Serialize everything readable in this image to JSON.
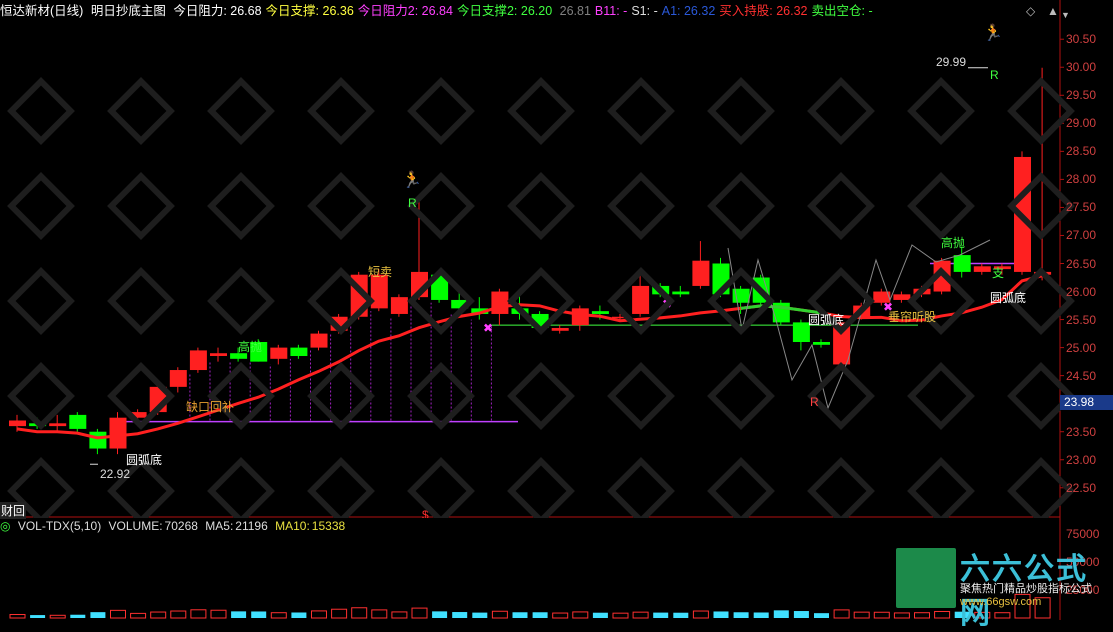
{
  "header": {
    "stock_name": "恒达新材(日线)",
    "indicator_name": "明日抄底主图",
    "items": [
      {
        "label": "今日阻力:",
        "value": "26.68",
        "color": "#ffffff"
      },
      {
        "label": "今日支撑:",
        "value": "26.36",
        "color": "#ffff40"
      },
      {
        "label": "今日阻力2:",
        "value": "26.84",
        "color": "#ff40ff"
      },
      {
        "label": "今日支撑2:",
        "value": "26.20",
        "color": "#40ff40"
      },
      {
        "label": "",
        "value": "26.81",
        "color": "#808080"
      },
      {
        "label": "B11:",
        "value": "-",
        "color": "#ff40ff"
      },
      {
        "label": "S1:",
        "value": "-",
        "color": "#dddddd"
      },
      {
        "label": "A1:",
        "value": "26.32",
        "color": "#2a58d8"
      },
      {
        "label": "买入持股:",
        "value": "26.32",
        "color": "#ff3030"
      },
      {
        "label": "卖出空仓:",
        "value": "-",
        "color": "#40ff40"
      }
    ],
    "controls": {
      "diamond": "◇",
      "up": "▲",
      "down": "▼"
    }
  },
  "colors": {
    "up": "#ff2020",
    "down": "#00ff00",
    "bg": "#000000",
    "axis": "#b01010"
  },
  "price_axis": {
    "ticks": [
      "30.50",
      "30.00",
      "29.50",
      "29.00",
      "28.50",
      "28.00",
      "27.50",
      "27.00",
      "26.50",
      "26.00",
      "25.50",
      "25.00",
      "24.50",
      "24.00",
      "23.50",
      "23.00",
      "22.50"
    ],
    "current_price": "23.98"
  },
  "volume_header": {
    "name": "VOL-TDX(5,10)",
    "volume_label": "VOLUME:",
    "volume": "70268",
    "ma5_label": "MA5:",
    "ma5": "21196",
    "ma10_label": "MA10:",
    "ma10": "15338"
  },
  "volume_axis": {
    "ticks": [
      "75000",
      "50000",
      "25000"
    ]
  },
  "annotations": {
    "peak_high": "29.99",
    "low": "22.92",
    "yuanhudi1": "圆弧底",
    "yuanhudi2": "圆弧底",
    "yuanhudi3": "圆弧底",
    "queko": "缺口回补",
    "gaopao1": "高抛",
    "gaopao2": "高抛",
    "duanmai": "短卖",
    "chuilian": "垂帘听股",
    "zhi": "支",
    "r1": "R",
    "r2": "R",
    "r3": "R",
    "caihui": "财回"
  },
  "watermark": {
    "title": "六六公式网",
    "sub": "聚焦热门精品炒股指标公式",
    "url": "www.66gsw.com"
  },
  "chart_data": {
    "type": "candlestick",
    "ylim": [
      22.3,
      30.7
    ],
    "candles": [
      {
        "o": 23.6,
        "h": 23.8,
        "l": 23.5,
        "c": 23.7
      },
      {
        "o": 23.65,
        "h": 23.75,
        "l": 23.55,
        "c": 23.6
      },
      {
        "o": 23.6,
        "h": 23.8,
        "l": 23.5,
        "c": 23.65
      },
      {
        "o": 23.8,
        "h": 23.85,
        "l": 23.5,
        "c": 23.55
      },
      {
        "o": 23.5,
        "h": 23.55,
        "l": 23.1,
        "c": 23.2
      },
      {
        "o": 23.2,
        "h": 23.85,
        "l": 23.1,
        "c": 23.75
      },
      {
        "o": 23.75,
        "h": 23.9,
        "l": 23.6,
        "c": 23.85
      },
      {
        "o": 23.85,
        "h": 24.35,
        "l": 23.8,
        "c": 24.3
      },
      {
        "o": 24.3,
        "h": 24.65,
        "l": 24.2,
        "c": 24.6
      },
      {
        "o": 24.6,
        "h": 25.0,
        "l": 24.55,
        "c": 24.95
      },
      {
        "o": 24.85,
        "h": 25.0,
        "l": 24.75,
        "c": 24.9
      },
      {
        "o": 24.9,
        "h": 25.0,
        "l": 24.75,
        "c": 24.8
      },
      {
        "o": 25.1,
        "h": 25.15,
        "l": 24.75,
        "c": 24.75
      },
      {
        "o": 24.8,
        "h": 25.05,
        "l": 24.7,
        "c": 25.0
      },
      {
        "o": 25.0,
        "h": 25.05,
        "l": 24.8,
        "c": 24.85
      },
      {
        "o": 25.0,
        "h": 25.3,
        "l": 24.95,
        "c": 25.25
      },
      {
        "o": 25.3,
        "h": 25.6,
        "l": 25.25,
        "c": 25.55
      },
      {
        "o": 25.55,
        "h": 26.35,
        "l": 25.5,
        "c": 26.3
      },
      {
        "o": 25.7,
        "h": 26.4,
        "l": 25.65,
        "c": 26.3
      },
      {
        "o": 25.6,
        "h": 25.95,
        "l": 25.55,
        "c": 25.9
      },
      {
        "o": 25.9,
        "h": 27.65,
        "l": 25.85,
        "c": 26.35
      },
      {
        "o": 26.3,
        "h": 26.35,
        "l": 25.8,
        "c": 25.85
      },
      {
        "o": 25.85,
        "h": 26.0,
        "l": 25.6,
        "c": 25.7
      },
      {
        "o": 25.7,
        "h": 25.9,
        "l": 25.5,
        "c": 25.6
      },
      {
        "o": 25.6,
        "h": 26.05,
        "l": 25.4,
        "c": 26.0
      },
      {
        "o": 25.7,
        "h": 26.0,
        "l": 25.5,
        "c": 25.6
      },
      {
        "o": 25.6,
        "h": 25.65,
        "l": 25.3,
        "c": 25.35
      },
      {
        "o": 25.3,
        "h": 25.4,
        "l": 25.25,
        "c": 25.35
      },
      {
        "o": 25.4,
        "h": 25.75,
        "l": 25.3,
        "c": 25.7
      },
      {
        "o": 25.65,
        "h": 25.75,
        "l": 25.5,
        "c": 25.6
      },
      {
        "o": 25.55,
        "h": 25.6,
        "l": 25.5,
        "c": 25.55
      },
      {
        "o": 25.6,
        "h": 26.3,
        "l": 25.55,
        "c": 26.1
      },
      {
        "o": 26.1,
        "h": 26.15,
        "l": 25.9,
        "c": 25.95
      },
      {
        "o": 26.0,
        "h": 26.1,
        "l": 25.9,
        "c": 25.95
      },
      {
        "o": 26.1,
        "h": 26.9,
        "l": 26.05,
        "c": 26.55
      },
      {
        "o": 26.5,
        "h": 26.6,
        "l": 25.9,
        "c": 25.95
      },
      {
        "o": 26.05,
        "h": 26.1,
        "l": 25.6,
        "c": 25.8
      },
      {
        "o": 26.25,
        "h": 26.3,
        "l": 25.75,
        "c": 25.8
      },
      {
        "o": 25.8,
        "h": 25.85,
        "l": 25.4,
        "c": 25.45
      },
      {
        "o": 25.45,
        "h": 25.5,
        "l": 24.95,
        "c": 25.1
      },
      {
        "o": 25.1,
        "h": 25.15,
        "l": 25.0,
        "c": 25.05
      },
      {
        "o": 24.7,
        "h": 25.45,
        "l": 24.65,
        "c": 25.45
      },
      {
        "o": 25.55,
        "h": 25.8,
        "l": 25.5,
        "c": 25.75
      },
      {
        "o": 25.8,
        "h": 26.05,
        "l": 25.75,
        "c": 26.0
      },
      {
        "o": 25.85,
        "h": 26.0,
        "l": 25.8,
        "c": 25.95
      },
      {
        "o": 25.95,
        "h": 26.1,
        "l": 25.9,
        "c": 26.05
      },
      {
        "o": 26.0,
        "h": 26.6,
        "l": 25.95,
        "c": 26.55
      },
      {
        "o": 26.65,
        "h": 26.8,
        "l": 26.25,
        "c": 26.35
      },
      {
        "o": 26.35,
        "h": 26.5,
        "l": 26.3,
        "c": 26.45
      },
      {
        "o": 26.4,
        "h": 26.5,
        "l": 26.3,
        "c": 26.45
      },
      {
        "o": 26.35,
        "h": 28.5,
        "l": 26.3,
        "c": 28.4
      },
      {
        "o": 26.3,
        "h": 29.99,
        "l": 26.2,
        "c": 26.35
      }
    ],
    "volume": [
      3100,
      2600,
      2400,
      2900,
      5200,
      6800,
      4100,
      5300,
      6200,
      7300,
      6900,
      5900,
      5800,
      4700,
      4900,
      6300,
      7800,
      9100,
      7200,
      5400,
      8800,
      5900,
      5300,
      4800,
      6000,
      5100,
      5100,
      4400,
      5400,
      4700,
      4300,
      5200,
      4800,
      4700,
      6200,
      5800,
      5100,
      4900,
      6800,
      6200,
      4300,
      7200,
      5200,
      5100,
      4500,
      4700,
      5800,
      5600,
      5000,
      4700,
      21000,
      18000
    ]
  }
}
